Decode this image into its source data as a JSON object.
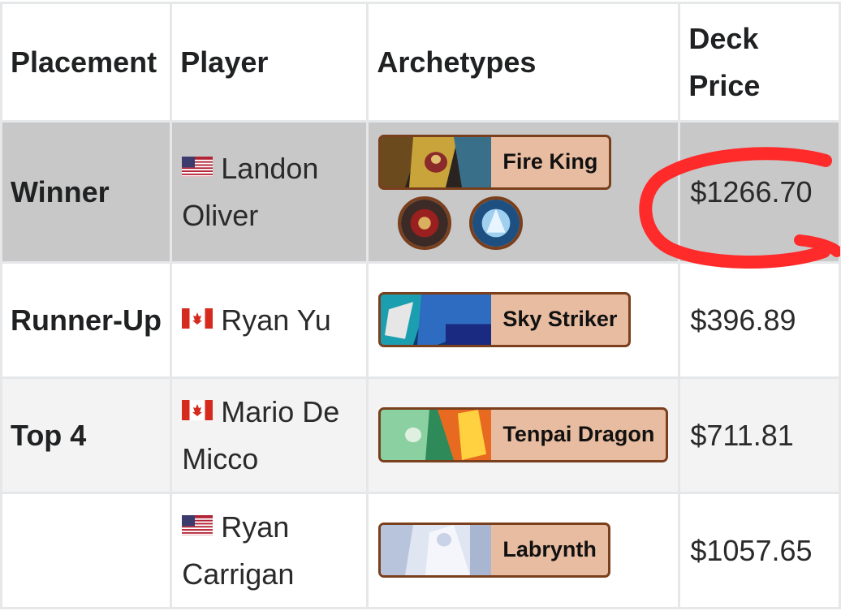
{
  "table": {
    "headers": {
      "placement": "Placement",
      "player": "Player",
      "archetypes": "Archetypes",
      "deck_price_line1": "Deck",
      "deck_price_line2": "Price"
    },
    "rows": [
      {
        "placement": "Winner",
        "flag": "us-flag-icon",
        "player": "Landon Oliver",
        "archetype": "Fire King",
        "price": "$1266.70"
      },
      {
        "placement": "Runner-Up",
        "flag": "canada-flag-icon",
        "player": "Ryan Yu",
        "archetype": "Sky Striker",
        "price": "$396.89"
      },
      {
        "placement": "Top 4",
        "flag": "canada-flag-icon",
        "player": "Mario De Micco",
        "archetype": "Tenpai Dragon",
        "price": "$711.81"
      },
      {
        "placement": "",
        "flag": "us-flag-icon",
        "player": "Ryan Carrigan",
        "archetype": "Labrynth",
        "price": "$1057.65"
      }
    ]
  },
  "annotation": {
    "color": "#ff2a2a"
  },
  "colors": {
    "badge_bg": "#e8bca0",
    "badge_border": "#7a3f1c",
    "highlight_row": "#c8c8c8"
  }
}
